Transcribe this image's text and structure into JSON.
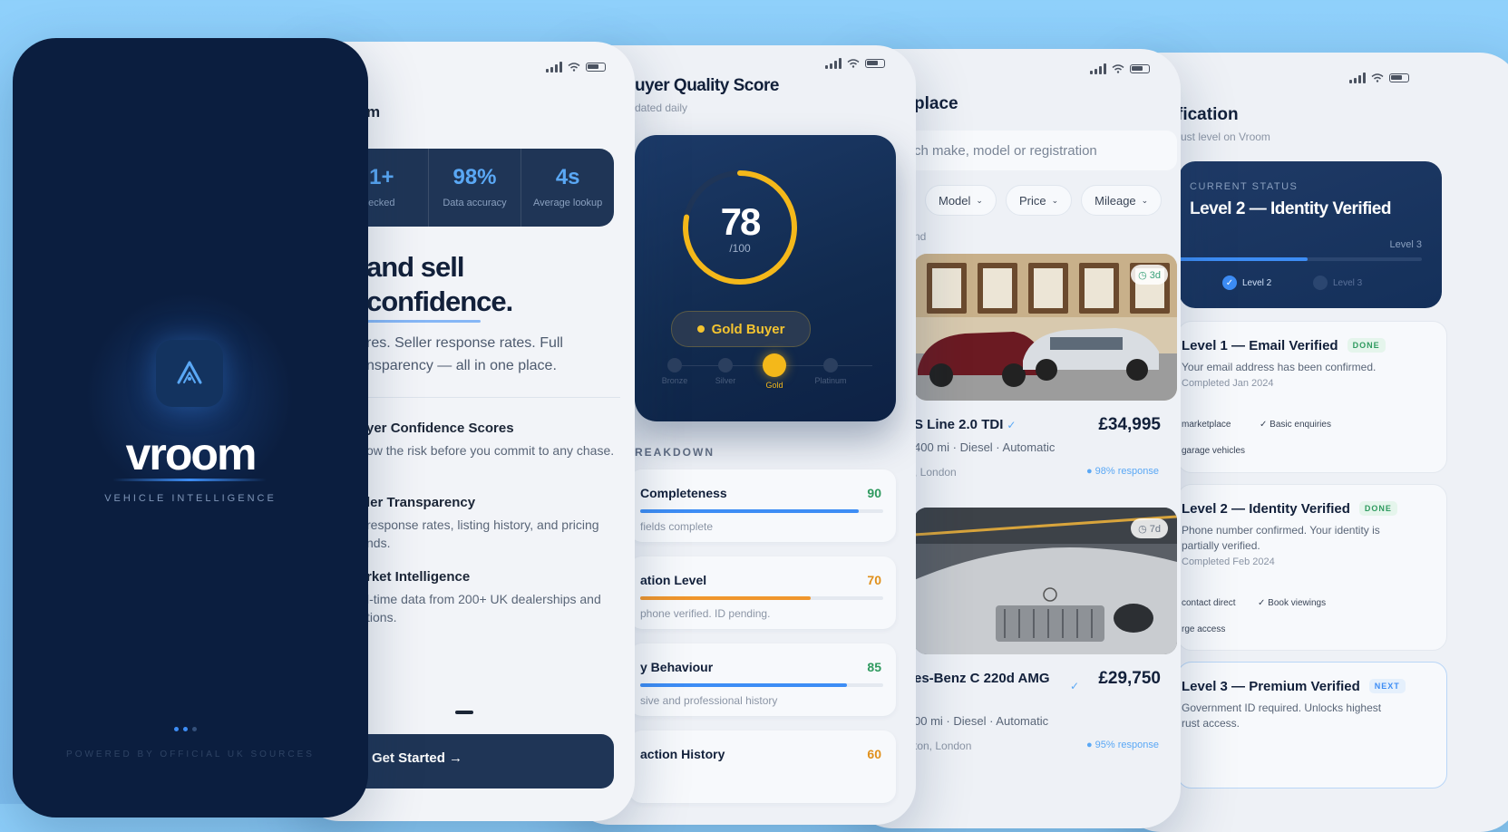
{
  "status_bar": {
    "icons": [
      "signal-icon",
      "wifi-icon",
      "battery-icon"
    ]
  },
  "splash": {
    "brand": "vroom",
    "tagline": "VEHICLE INTELLIGENCE",
    "powered_by": "POWERED BY OFFICIAL UK SOURCES",
    "logo_icon": "chevron-up-logo-icon",
    "accent": "#3d8df5",
    "background": "#0b1e3f"
  },
  "onboarding": {
    "partial_title": "m",
    "stats": [
      {
        "value": "1+",
        "label": "ecked"
      },
      {
        "value": "98%",
        "label": "Data accuracy"
      },
      {
        "value": "4s",
        "label": "Average lookup"
      }
    ],
    "headline_line1": "and sell",
    "headline_line2": "confidence.",
    "lead": "res. Seller response rates. Full nsparency — all in one place.",
    "features": [
      {
        "title": "yer Confidence Scores",
        "desc": "ow the risk before you commit to any chase."
      },
      {
        "title": "ler Transparency",
        "desc": "response rates, listing history, and pricing nds."
      },
      {
        "title": "rket Intelligence",
        "desc": "l-time data from 200+ UK dealerships and tions."
      }
    ],
    "cta": "Get Started →"
  },
  "quality": {
    "title": "uyer Quality Score",
    "subtitle": "dated daily",
    "score": "78",
    "score_max": "/100",
    "score_value": 78,
    "badge": "Gold Buyer",
    "tiers": [
      "Bronze",
      "Silver",
      "Gold",
      "Platinum"
    ],
    "active_tier": "Gold",
    "breakdown_label": "REAKDOWN",
    "breakdown": [
      {
        "name": "Completeness",
        "value": "90",
        "fraction": 0.9,
        "color": "#3d8df5",
        "value_color": "#2f9a5f",
        "desc": "fields complete"
      },
      {
        "name": "ation Level",
        "value": "70",
        "fraction": 0.7,
        "color": "#f0962c",
        "value_color": "#e0901c",
        "desc": "phone verified. ID pending."
      },
      {
        "name": "y Behaviour",
        "value": "85",
        "fraction": 0.85,
        "color": "#3d8df5",
        "value_color": "#2f9a5f",
        "desc": "sive and professional history"
      },
      {
        "name": "action History",
        "value": "60",
        "fraction": 0.6,
        "color": "#f0962c",
        "value_color": "#e0901c",
        "desc": ""
      }
    ],
    "gold": "#f4b81a"
  },
  "marketplace": {
    "title": "place",
    "search_placeholder": "ch make, model or registration",
    "filters": [
      "Model",
      "Price",
      "Mileage"
    ],
    "found_label": "nd",
    "listings": [
      {
        "title": "S Line 2.0 TDI",
        "price": "£34,995",
        "meta": "400 mi · Diesel · Automatic",
        "location": ", London",
        "response": "● 98% response",
        "age": "◷ 3d"
      },
      {
        "title": "es-Benz C 220d AMG",
        "price": "£29,750",
        "meta": "00 mi · Diesel · Automatic",
        "location": "ton, London",
        "response": "● 95% response",
        "age": "◷ 7d"
      }
    ]
  },
  "verification": {
    "title": "fication",
    "subtitle": "rust level on Vroom",
    "current_caption": "CURRENT STATUS",
    "current_level": "Level 2 — Identity Verified",
    "next_level": "Level 3",
    "progress": 0.53,
    "steps": [
      "Level 2",
      "Level 3"
    ],
    "levels": [
      {
        "title": "Level 1 — Email Verified",
        "tag": "DONE",
        "desc": "Your email address has been confirmed.",
        "completed": "Completed Jan 2024",
        "perks": [
          "marketplace",
          "✓ Basic enquiries",
          "garage vehicles"
        ]
      },
      {
        "title": "Level 2 — Identity Verified",
        "tag": "DONE",
        "desc": "Phone number confirmed. Your identity is partially verified.",
        "completed": "Completed Feb 2024",
        "perks": [
          "contact direct",
          "✓ Book viewings",
          "rge access"
        ]
      },
      {
        "title": "Level 3 — Premium Verified",
        "tag": "NEXT",
        "desc": "Government ID required. Unlocks highest rust access.",
        "completed": "",
        "perks": []
      }
    ]
  }
}
